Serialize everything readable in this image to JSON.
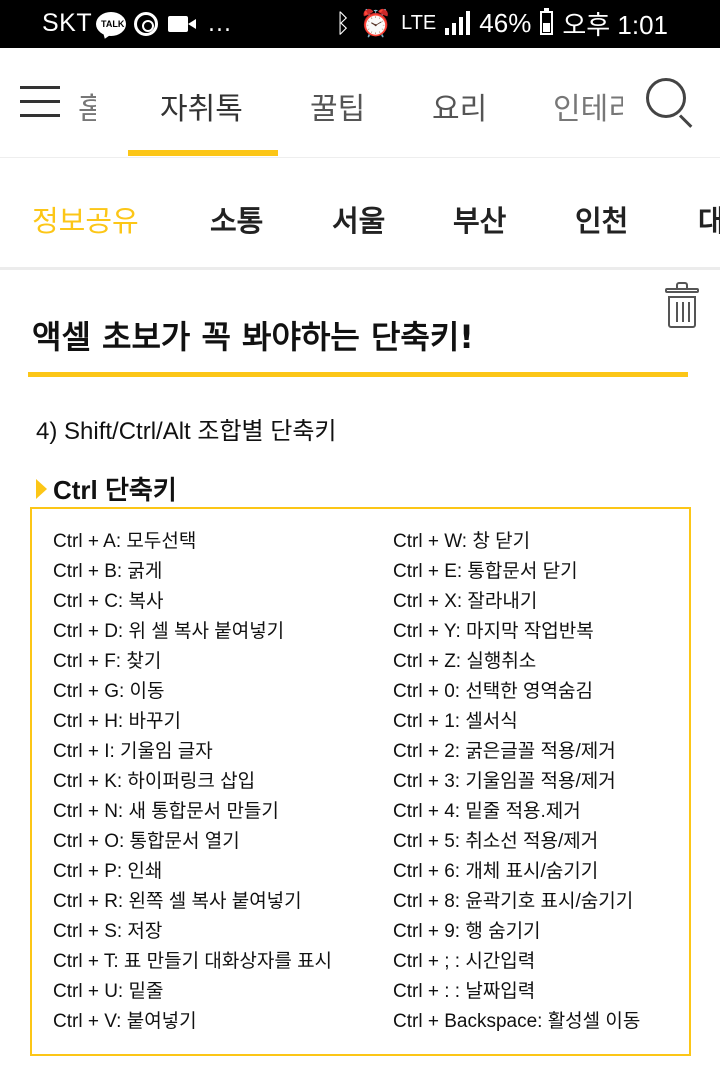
{
  "status_bar": {
    "carrier": "SKT",
    "talk_icon_text": "TALK",
    "lte": "LTE",
    "battery": "46%",
    "time": "오후 1:01",
    "more": "..."
  },
  "top_nav": {
    "menu_label": "메뉴",
    "tabs": [
      {
        "label": "홈",
        "partial": true
      },
      {
        "label": "자취톡",
        "active": true
      },
      {
        "label": "꿀팁"
      },
      {
        "label": "요리"
      },
      {
        "label": "인테리어",
        "partial": true
      }
    ]
  },
  "category_nav": {
    "tabs": [
      {
        "label": "정보공유",
        "active": true
      },
      {
        "label": "소통"
      },
      {
        "label": "서울"
      },
      {
        "label": "부산"
      },
      {
        "label": "인천"
      },
      {
        "label": "대구",
        "partial": true
      }
    ]
  },
  "article": {
    "title": "액셀 초보가 꼭 봐야하는 단축키!",
    "section_heading": "4) Shift/Ctrl/Alt 조합별 단축키",
    "sub_heading": "Ctrl 단축키",
    "shortcuts_left": [
      "Ctrl + A: 모두선택",
      "Ctrl + B: 굵게",
      "Ctrl + C: 복사",
      "Ctrl + D: 위 셀 복사 붙여넣기",
      "Ctrl + F: 찾기",
      "Ctrl + G: 이동",
      "Ctrl + H: 바꾸기",
      "Ctrl + I: 기울임 글자",
      "Ctrl + K: 하이퍼링크 삽입",
      "Ctrl + N: 새 통합문서 만들기",
      "Ctrl + O: 통합문서 열기",
      "Ctrl + P: 인쇄",
      "Ctrl + R: 왼쪽 셀 복사 붙여넣기",
      "Ctrl + S: 저장",
      "Ctrl + T: 표 만들기 대화상자를 표시",
      "Ctrl + U: 밑줄",
      "Ctrl + V: 붙여넣기"
    ],
    "shortcuts_right": [
      "Ctrl + W: 창 닫기",
      "Ctrl + E: 통합문서 닫기",
      "Ctrl + X: 잘라내기",
      "Ctrl + Y: 마지막 작업반복",
      "Ctrl + Z: 실행취소",
      "Ctrl + 0: 선택한 영역숨김",
      "Ctrl + 1: 셀서식",
      "Ctrl + 2: 굵은글꼴 적용/제거",
      "Ctrl + 3: 기울임꼴 적용/제거",
      "Ctrl + 4: 밑줄 적용.제거",
      "Ctrl + 5: 취소선 적용/제거",
      "Ctrl + 6: 개체 표시/숨기기",
      "Ctrl + 8: 윤곽기호 표시/숨기기",
      "Ctrl + 9: 행 숨기기",
      "Ctrl + ; : 시간입력",
      "Ctrl + : : 날짜입력",
      "Ctrl + Backspace: 활성셀 이동"
    ]
  },
  "colors": {
    "accent": "#fcc617",
    "status_bar_bg": "#000000",
    "text": "#111111"
  },
  "icons": [
    "talk-icon",
    "ring-icon",
    "camera-icon",
    "bluetooth-icon",
    "alarm-icon",
    "signal-icon",
    "battery-icon",
    "hamburger-icon",
    "search-icon",
    "trash-icon",
    "triangle-bullet-icon"
  ]
}
